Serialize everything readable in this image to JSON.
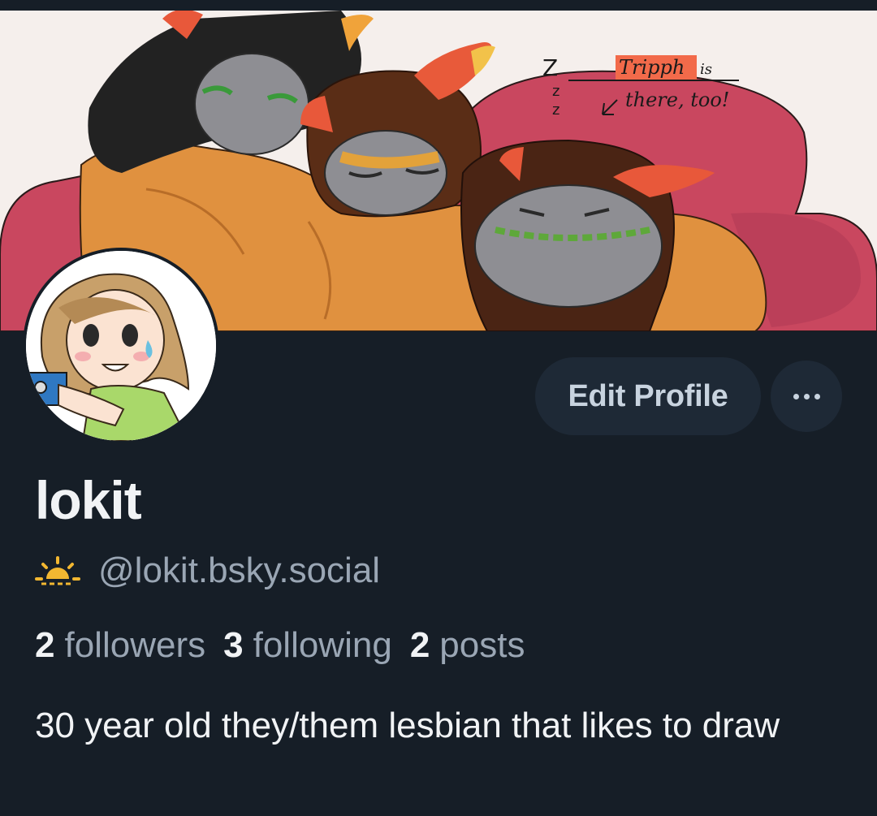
{
  "banner": {
    "annotation_name": "Tripph",
    "annotation_rest": "is",
    "annotation_line2": "there, too!",
    "zzz": "Z",
    "zzz_small": "z"
  },
  "profile": {
    "display_name": "lokit",
    "handle": "@lokit.bsky.social",
    "handle_icon": "sunrise-icon",
    "bio": "30 year old they/them lesbian that likes to draw"
  },
  "stats": {
    "followers_count": "2",
    "followers_label": "followers",
    "following_count": "3",
    "following_label": "following",
    "posts_count": "2",
    "posts_label": "posts"
  },
  "actions": {
    "edit_label": "Edit Profile"
  },
  "colors": {
    "background": "#161e27",
    "button_bg": "#1e2936",
    "muted_text": "#9aa6b4",
    "primary_text": "#f1f3f5",
    "sun_icon": "#f2b731"
  }
}
